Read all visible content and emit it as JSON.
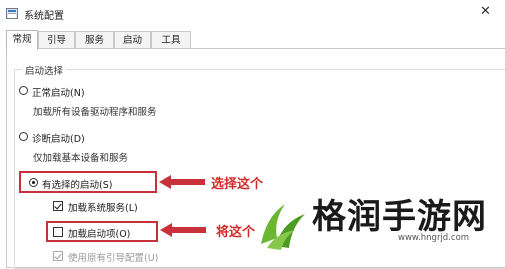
{
  "window": {
    "title": "系统配置",
    "close_glyph": "✕"
  },
  "tabs": [
    {
      "label": "常规",
      "active": true
    },
    {
      "label": "引导",
      "active": false
    },
    {
      "label": "服务",
      "active": false
    },
    {
      "label": "启动",
      "active": false
    },
    {
      "label": "工具",
      "active": false
    }
  ],
  "startup_selection": {
    "legend": "启动选择",
    "options": [
      {
        "label": "正常启动(N)",
        "description": "加载所有设备驱动程序和服务",
        "selected": false
      },
      {
        "label": "诊断启动(D)",
        "description": "仅加载基本设备和服务",
        "selected": false
      },
      {
        "label": "有选择的启动(S)",
        "selected": true
      }
    ],
    "checkboxes": [
      {
        "label": "加载系统服务(L)",
        "checked": true,
        "enabled": true
      },
      {
        "label": "加载启动项(O)",
        "checked": false,
        "enabled": true
      },
      {
        "label": "使用原有引导配置(U)",
        "checked": true,
        "enabled": false
      }
    ]
  },
  "annotations": {
    "select_this": "选择这个",
    "this_one": "将这个",
    "color": "#d42a2a"
  },
  "watermark": {
    "text": "格润手游网",
    "url": "www.hngrjd.com",
    "logo_color": "#6ab832"
  }
}
